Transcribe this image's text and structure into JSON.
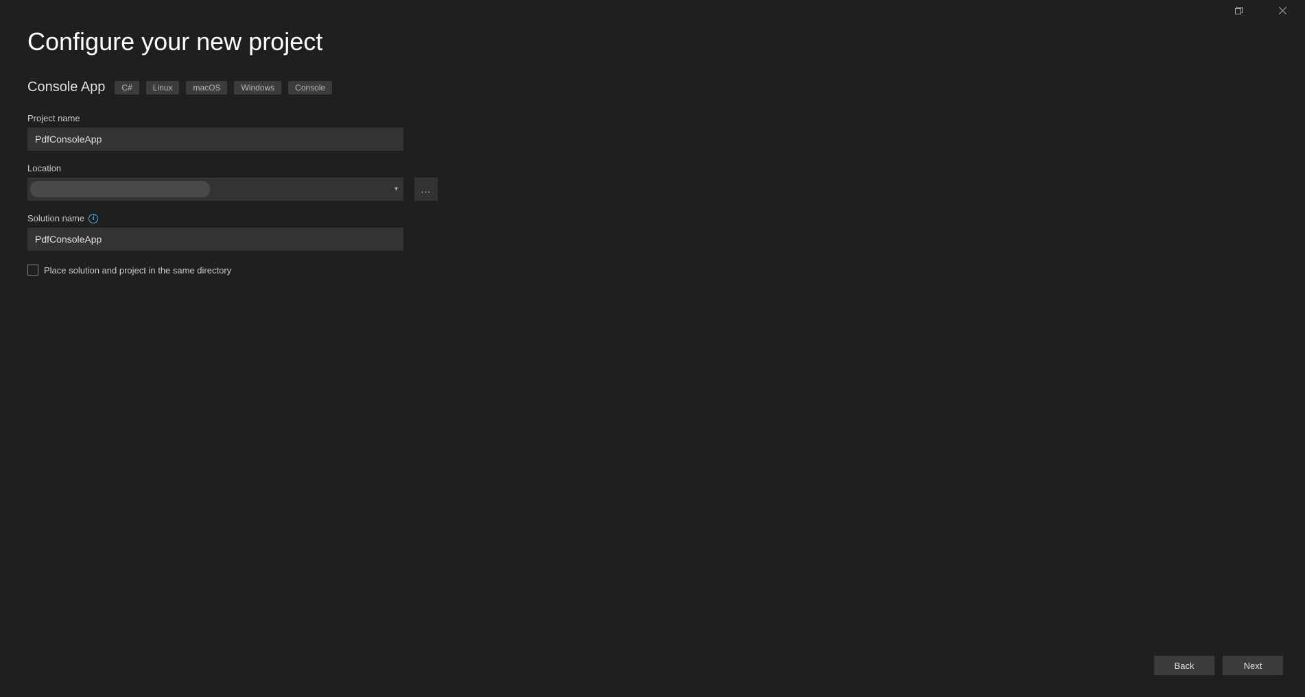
{
  "window": {
    "maximize_icon": "maximize",
    "close_icon": "close"
  },
  "header": {
    "title": "Configure your new project",
    "subtitle": "Console App",
    "tags": [
      "C#",
      "Linux",
      "macOS",
      "Windows",
      "Console"
    ]
  },
  "form": {
    "project_name": {
      "label": "Project name",
      "value": "PdfConsoleApp"
    },
    "location": {
      "label": "Location",
      "value": "",
      "browse_label": "..."
    },
    "solution_name": {
      "label": "Solution name",
      "value": "PdfConsoleApp",
      "info_tooltip": "i"
    },
    "same_dir_checkbox": {
      "label": "Place solution and project in the same directory",
      "checked": false
    }
  },
  "footer": {
    "back_label": "Back",
    "next_label": "Next"
  }
}
